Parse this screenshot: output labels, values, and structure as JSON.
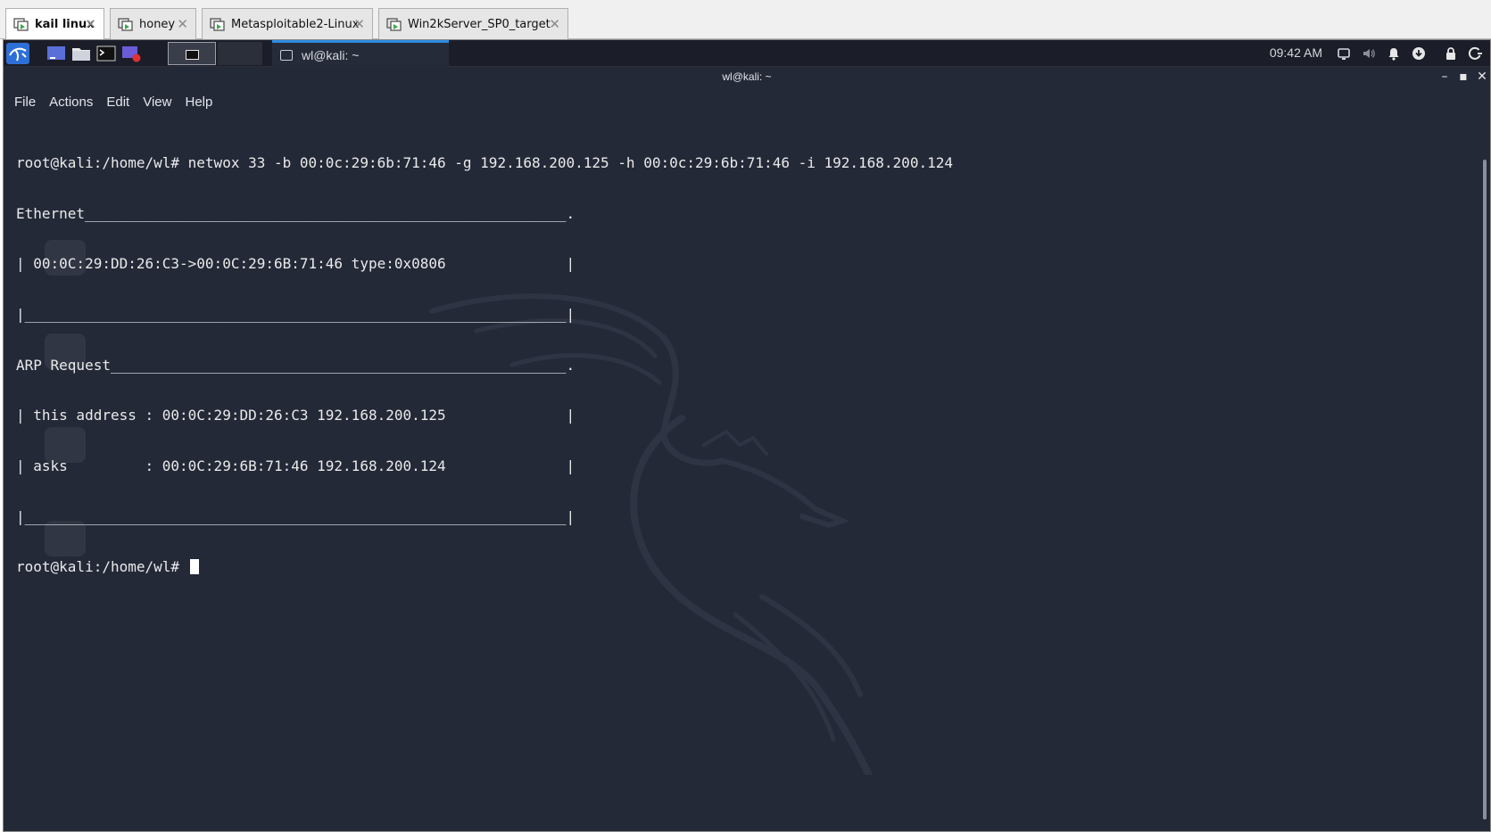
{
  "vm_tabs": [
    {
      "label": "kail linux",
      "active": true
    },
    {
      "label": "honey",
      "active": false
    },
    {
      "label": "Metasploitable2-Linux",
      "active": false
    },
    {
      "label": "Win2kServer_SP0_target",
      "active": false
    }
  ],
  "panel": {
    "launchers": [
      "kali-menu-icon",
      "desktop-icon",
      "file-manager-icon",
      "terminal-icon",
      "screen-recorder-icon"
    ],
    "taskbar_item": "wl@kali: ~",
    "clock": "09:42 AM",
    "tray": [
      "display-icon",
      "volume-icon",
      "notification-bell-icon",
      "update-icon",
      "lock-icon",
      "power-icon"
    ]
  },
  "window": {
    "title": "wl@kali: ~",
    "menu": [
      "File",
      "Actions",
      "Edit",
      "View",
      "Help"
    ]
  },
  "terminal": {
    "lines": [
      "root@kali:/home/wl# netwox 33 -b 00:0c:29:6b:71:46 -g 192.168.200.125 -h 00:0c:29:6b:71:46 -i 192.168.200.124",
      "Ethernet________________________________________________________.",
      "| 00:0C:29:DD:26:C3->00:0C:29:6B:71:46 type:0x0806              |",
      "|_______________________________________________________________|",
      "ARP Request_____________________________________________________.",
      "| this address : 00:0C:29:DD:26:C3 192.168.200.125              |",
      "| asks         : 00:0C:29:6B:71:46 192.168.200.124              |",
      "|_______________________________________________________________|"
    ],
    "prompt": "root@kali:/home/wl# "
  },
  "colors": {
    "terminal_bg": "#242938",
    "panel_bg": "#1b1e28",
    "accent": "#2f8be0",
    "text": "#eaeaea"
  }
}
